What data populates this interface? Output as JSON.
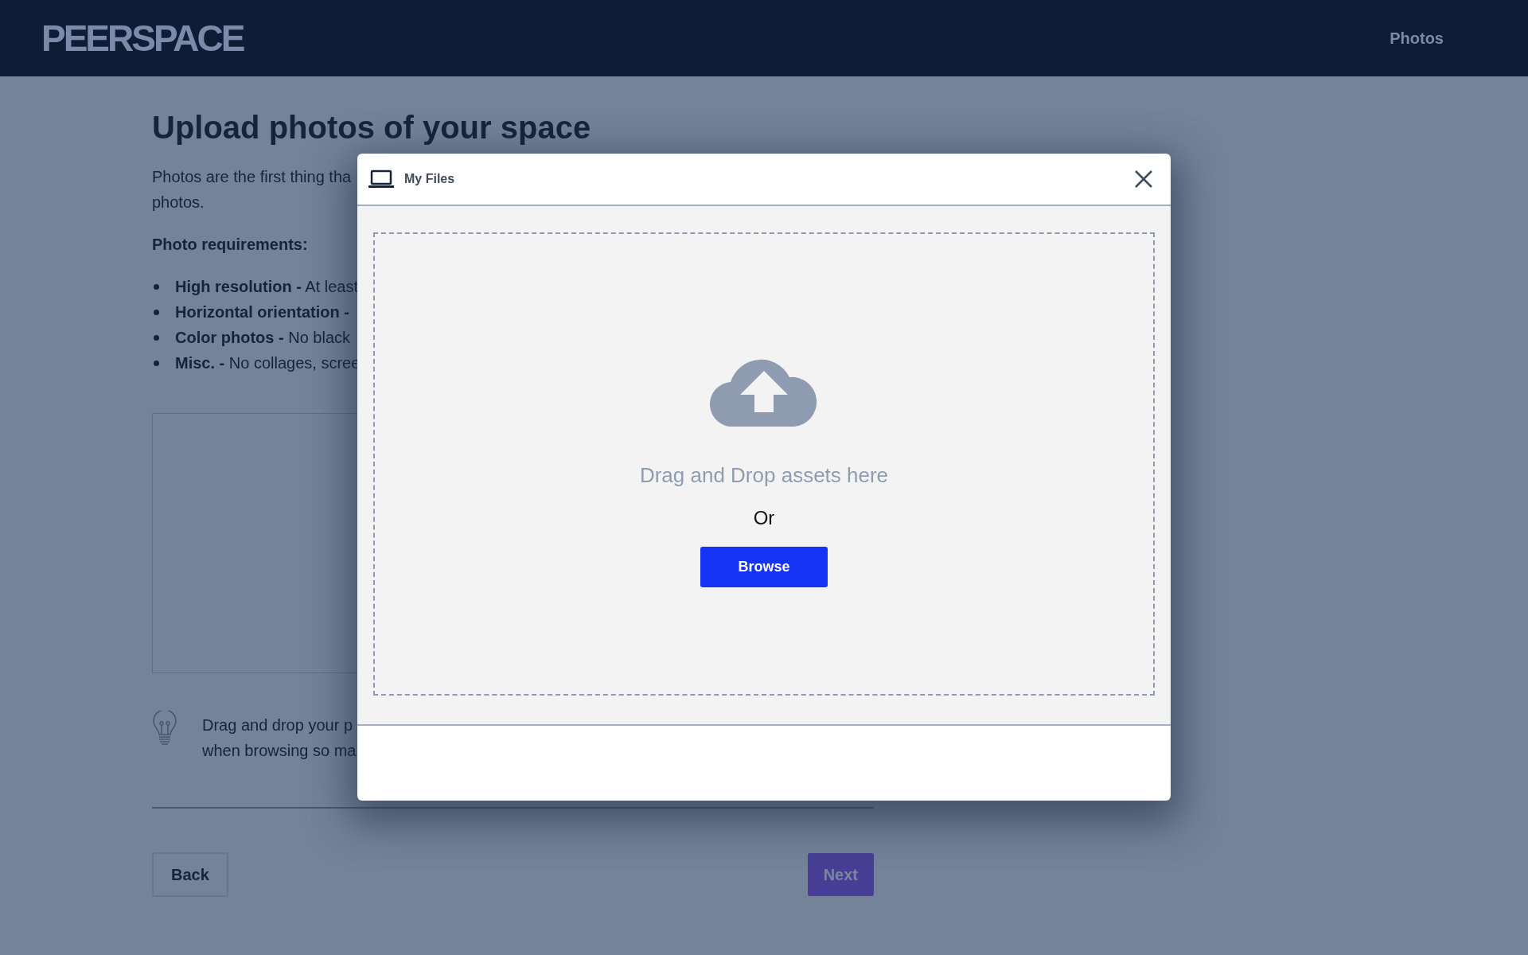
{
  "header": {
    "logo": "PEERSPACE",
    "nav_link": "Photos"
  },
  "page": {
    "title": "Upload photos of your space",
    "intro": [
      "Photos are the first thing tha",
      "photos."
    ],
    "requirements_heading": "Photo requirements:",
    "requirements": [
      "**High resolution -** At least",
      "**Horizontal orientation -**",
      "**Color photos -** No black",
      "**Misc. -** No collages, scree"
    ],
    "tip": [
      "Drag and drop your p",
      "when browsing so ma"
    ]
  },
  "buttons": {
    "back": "Back",
    "next": "Next"
  },
  "modal": {
    "title": "My Files",
    "drop_text": "Drag and Drop assets here",
    "or": "Or",
    "browse": "Browse"
  }
}
